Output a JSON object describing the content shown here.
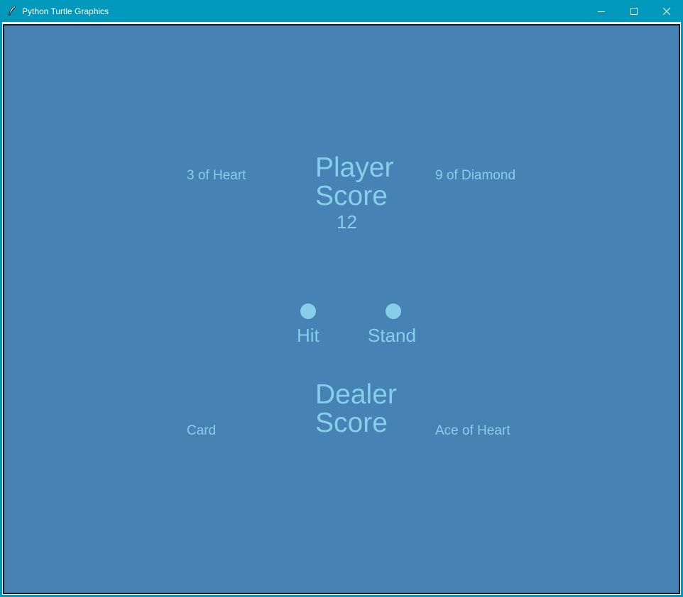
{
  "window": {
    "title": "Python Turtle Graphics",
    "icons": {
      "app": "feather-icon",
      "minimize": "minimize-icon",
      "maximize": "maximize-icon",
      "close": "close-icon"
    }
  },
  "colors": {
    "titlebar": "#0099bc",
    "canvas_background": "#4682b4",
    "text": "#87ceeb"
  },
  "game": {
    "player": {
      "label_line1": "Player",
      "label_line2": "Score",
      "score": "12",
      "card_left": "3 of Heart",
      "card_right": "9 of Diamond"
    },
    "buttons": {
      "hit_label": "Hit",
      "stand_label": "Stand"
    },
    "dealer": {
      "label_line1": "Dealer",
      "label_line2": "Score",
      "card_left": "Card",
      "card_right": "Ace of Heart"
    }
  }
}
